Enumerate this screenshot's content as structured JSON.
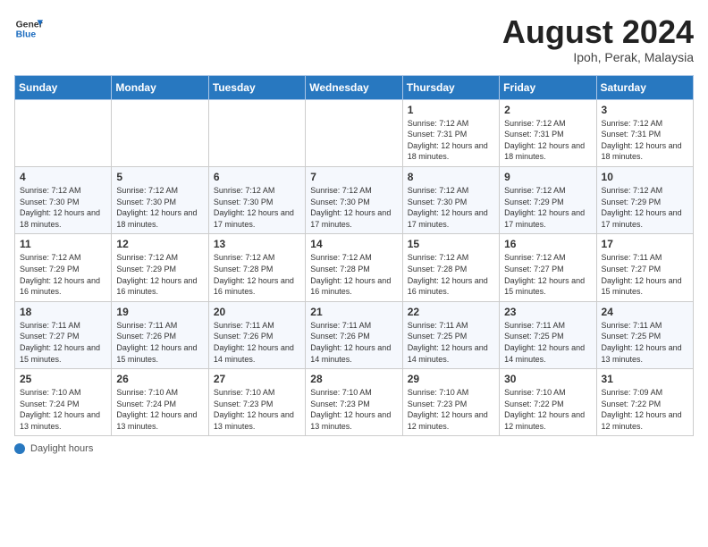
{
  "header": {
    "logo_general": "General",
    "logo_blue": "Blue",
    "month_year": "August 2024",
    "location": "Ipoh, Perak, Malaysia"
  },
  "days_of_week": [
    "Sunday",
    "Monday",
    "Tuesday",
    "Wednesday",
    "Thursday",
    "Friday",
    "Saturday"
  ],
  "footer": {
    "label": "Daylight hours"
  },
  "weeks": [
    [
      {
        "day": "",
        "info": ""
      },
      {
        "day": "",
        "info": ""
      },
      {
        "day": "",
        "info": ""
      },
      {
        "day": "",
        "info": ""
      },
      {
        "day": "1",
        "info": "Sunrise: 7:12 AM\nSunset: 7:31 PM\nDaylight: 12 hours\nand 18 minutes."
      },
      {
        "day": "2",
        "info": "Sunrise: 7:12 AM\nSunset: 7:31 PM\nDaylight: 12 hours\nand 18 minutes."
      },
      {
        "day": "3",
        "info": "Sunrise: 7:12 AM\nSunset: 7:31 PM\nDaylight: 12 hours\nand 18 minutes."
      }
    ],
    [
      {
        "day": "4",
        "info": "Sunrise: 7:12 AM\nSunset: 7:30 PM\nDaylight: 12 hours\nand 18 minutes."
      },
      {
        "day": "5",
        "info": "Sunrise: 7:12 AM\nSunset: 7:30 PM\nDaylight: 12 hours\nand 18 minutes."
      },
      {
        "day": "6",
        "info": "Sunrise: 7:12 AM\nSunset: 7:30 PM\nDaylight: 12 hours\nand 17 minutes."
      },
      {
        "day": "7",
        "info": "Sunrise: 7:12 AM\nSunset: 7:30 PM\nDaylight: 12 hours\nand 17 minutes."
      },
      {
        "day": "8",
        "info": "Sunrise: 7:12 AM\nSunset: 7:30 PM\nDaylight: 12 hours\nand 17 minutes."
      },
      {
        "day": "9",
        "info": "Sunrise: 7:12 AM\nSunset: 7:29 PM\nDaylight: 12 hours\nand 17 minutes."
      },
      {
        "day": "10",
        "info": "Sunrise: 7:12 AM\nSunset: 7:29 PM\nDaylight: 12 hours\nand 17 minutes."
      }
    ],
    [
      {
        "day": "11",
        "info": "Sunrise: 7:12 AM\nSunset: 7:29 PM\nDaylight: 12 hours\nand 16 minutes."
      },
      {
        "day": "12",
        "info": "Sunrise: 7:12 AM\nSunset: 7:29 PM\nDaylight: 12 hours\nand 16 minutes."
      },
      {
        "day": "13",
        "info": "Sunrise: 7:12 AM\nSunset: 7:28 PM\nDaylight: 12 hours\nand 16 minutes."
      },
      {
        "day": "14",
        "info": "Sunrise: 7:12 AM\nSunset: 7:28 PM\nDaylight: 12 hours\nand 16 minutes."
      },
      {
        "day": "15",
        "info": "Sunrise: 7:12 AM\nSunset: 7:28 PM\nDaylight: 12 hours\nand 16 minutes."
      },
      {
        "day": "16",
        "info": "Sunrise: 7:12 AM\nSunset: 7:27 PM\nDaylight: 12 hours\nand 15 minutes."
      },
      {
        "day": "17",
        "info": "Sunrise: 7:11 AM\nSunset: 7:27 PM\nDaylight: 12 hours\nand 15 minutes."
      }
    ],
    [
      {
        "day": "18",
        "info": "Sunrise: 7:11 AM\nSunset: 7:27 PM\nDaylight: 12 hours\nand 15 minutes."
      },
      {
        "day": "19",
        "info": "Sunrise: 7:11 AM\nSunset: 7:26 PM\nDaylight: 12 hours\nand 15 minutes."
      },
      {
        "day": "20",
        "info": "Sunrise: 7:11 AM\nSunset: 7:26 PM\nDaylight: 12 hours\nand 14 minutes."
      },
      {
        "day": "21",
        "info": "Sunrise: 7:11 AM\nSunset: 7:26 PM\nDaylight: 12 hours\nand 14 minutes."
      },
      {
        "day": "22",
        "info": "Sunrise: 7:11 AM\nSunset: 7:25 PM\nDaylight: 12 hours\nand 14 minutes."
      },
      {
        "day": "23",
        "info": "Sunrise: 7:11 AM\nSunset: 7:25 PM\nDaylight: 12 hours\nand 14 minutes."
      },
      {
        "day": "24",
        "info": "Sunrise: 7:11 AM\nSunset: 7:25 PM\nDaylight: 12 hours\nand 13 minutes."
      }
    ],
    [
      {
        "day": "25",
        "info": "Sunrise: 7:10 AM\nSunset: 7:24 PM\nDaylight: 12 hours\nand 13 minutes."
      },
      {
        "day": "26",
        "info": "Sunrise: 7:10 AM\nSunset: 7:24 PM\nDaylight: 12 hours\nand 13 minutes."
      },
      {
        "day": "27",
        "info": "Sunrise: 7:10 AM\nSunset: 7:23 PM\nDaylight: 12 hours\nand 13 minutes."
      },
      {
        "day": "28",
        "info": "Sunrise: 7:10 AM\nSunset: 7:23 PM\nDaylight: 12 hours\nand 13 minutes."
      },
      {
        "day": "29",
        "info": "Sunrise: 7:10 AM\nSunset: 7:23 PM\nDaylight: 12 hours\nand 12 minutes."
      },
      {
        "day": "30",
        "info": "Sunrise: 7:10 AM\nSunset: 7:22 PM\nDaylight: 12 hours\nand 12 minutes."
      },
      {
        "day": "31",
        "info": "Sunrise: 7:09 AM\nSunset: 7:22 PM\nDaylight: 12 hours\nand 12 minutes."
      }
    ]
  ]
}
